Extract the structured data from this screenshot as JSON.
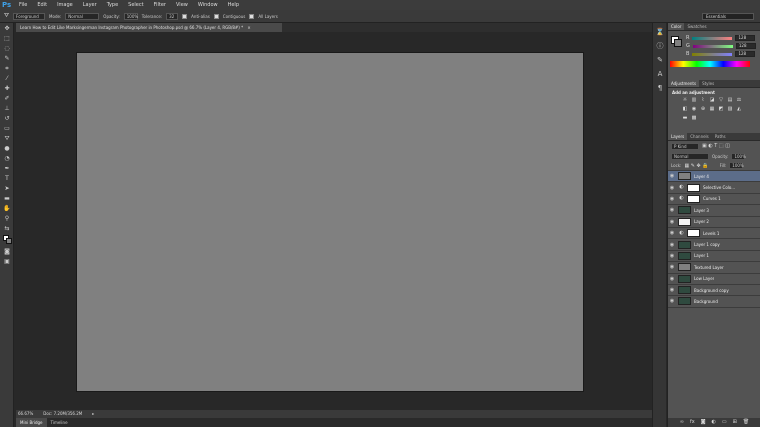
{
  "app": {
    "logo": "Ps",
    "workspace": "Essentials"
  },
  "menu": [
    "File",
    "Edit",
    "Image",
    "Layer",
    "Type",
    "Select",
    "Filter",
    "View",
    "Window",
    "Help"
  ],
  "options": {
    "tool_preset": "Foreground",
    "mode_label": "Mode:",
    "mode_value": "Normal",
    "opacity_label": "Opacity:",
    "opacity_value": "100%",
    "tolerance_label": "Tolerance:",
    "tolerance_value": "32",
    "anti_alias": "Anti-alias",
    "contiguous": "Contiguous",
    "all_layers": "All Layers"
  },
  "document": {
    "tab_title": "Learn How to Edit Like Marksingerman Instagram Photographer in Photoshop.psd @ 66.7% (Layer 4, RGB/8#) *",
    "close": "×"
  },
  "status": {
    "zoom": "66.67%",
    "doc": "Doc: 7.20M/356.2M"
  },
  "bottom_tabs": [
    "Mini Bridge",
    "Timeline"
  ],
  "color_panel": {
    "tabs": [
      "Color",
      "Swatches"
    ],
    "rows": [
      {
        "label": "R",
        "value": "128"
      },
      {
        "label": "G",
        "value": "128"
      },
      {
        "label": "B",
        "value": "128"
      }
    ]
  },
  "adjustments_panel": {
    "tabs": [
      "Adjustments",
      "Styles"
    ],
    "title": "Add an adjustment"
  },
  "layers_panel": {
    "tabs": [
      "Layers",
      "Channels",
      "Paths"
    ],
    "kind": "P Kind",
    "blend": "Normal",
    "opacity_label": "Opacity:",
    "opacity_value": "100%",
    "lock_label": "Lock:",
    "fill_label": "Fill:",
    "fill_value": "100%",
    "layers": [
      {
        "name": "Layer 4",
        "thumb": "gray",
        "selected": true
      },
      {
        "name": "Selective Colo...",
        "thumb": "mask",
        "adj": true
      },
      {
        "name": "Curves 1",
        "thumb": "mask",
        "adj": true
      },
      {
        "name": "Layer 3",
        "thumb": "green"
      },
      {
        "name": "Layer 2",
        "thumb": "white"
      },
      {
        "name": "Levels 1",
        "thumb": "mask",
        "adj": true
      },
      {
        "name": "Layer 1 copy",
        "thumb": "green"
      },
      {
        "name": "Layer 1",
        "thumb": "green"
      },
      {
        "name": "Textured Layer",
        "thumb": "gray"
      },
      {
        "name": "Low Layer",
        "thumb": "green"
      },
      {
        "name": "Background copy",
        "thumb": "green"
      },
      {
        "name": "Background",
        "thumb": "green"
      }
    ]
  }
}
